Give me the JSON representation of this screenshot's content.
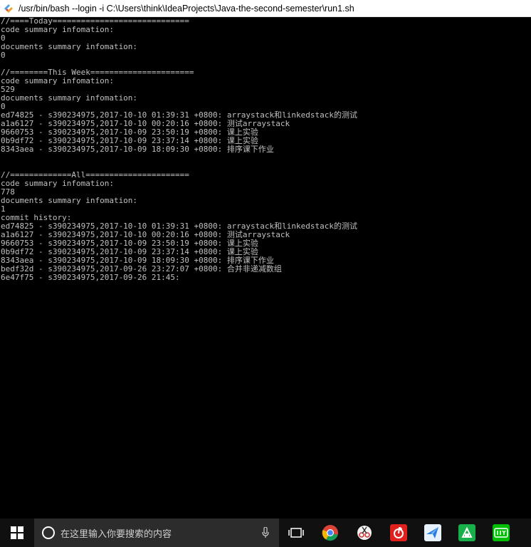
{
  "window": {
    "title": "/usr/bin/bash --login -i C:\\Users\\think\\IdeaProjects\\Java-the-second-semester\\run1.sh",
    "icon": "mintty-icon"
  },
  "console": {
    "lines": [
      "//====Today=============================",
      "code summary infomation:",
      "0",
      "documents summary infomation:",
      "0",
      "",
      "//========This Week======================",
      "code summary infomation:",
      "529",
      "documents summary infomation:",
      "0",
      "ed74825 - s390234975,2017-10-10 01:39:31 +0800: arraystack和linkedstack的测试",
      "a1a6127 - s390234975,2017-10-10 00:20:16 +0800: 测试arraystack",
      "9660753 - s390234975,2017-10-09 23:50:19 +0800: 课上实验",
      "0b9df72 - s390234975,2017-10-09 23:37:14 +0800: 课上实验",
      "8343aea - s390234975,2017-10-09 18:09:30 +0800: 排序课下作业",
      "",
      "",
      "//=============All======================",
      "code summary infomation:",
      "778",
      "documents summary infomation:",
      "1",
      "commit history:",
      "ed74825 - s390234975,2017-10-10 01:39:31 +0800: arraystack和linkedstack的测试",
      "a1a6127 - s390234975,2017-10-10 00:20:16 +0800: 测试arraystack",
      "9660753 - s390234975,2017-10-09 23:50:19 +0800: 课上实验",
      "0b9df72 - s390234975,2017-10-09 23:37:14 +0800: 课上实验",
      "8343aea - s390234975,2017-10-09 18:09:30 +0800: 排序课下作业",
      "bedf32d - s390234975,2017-09-26 23:27:07 +0800: 合并非递减数组",
      "6e47f75 - s390234975,2017-09-26 21:45:"
    ],
    "text_color": "#c0c0c0",
    "background": "#000000"
  },
  "taskbar": {
    "start_icon": "windows-logo-icon",
    "search_placeholder": "在这里输入你要搜索的内容",
    "apps": [
      {
        "name": "task-view-icon"
      },
      {
        "name": "chrome-icon"
      },
      {
        "name": "scissors-app-icon"
      },
      {
        "name": "netease-music-icon"
      },
      {
        "name": "feishu-bird-icon"
      },
      {
        "name": "green-app-icon"
      },
      {
        "name": "iqiyi-icon"
      }
    ]
  }
}
